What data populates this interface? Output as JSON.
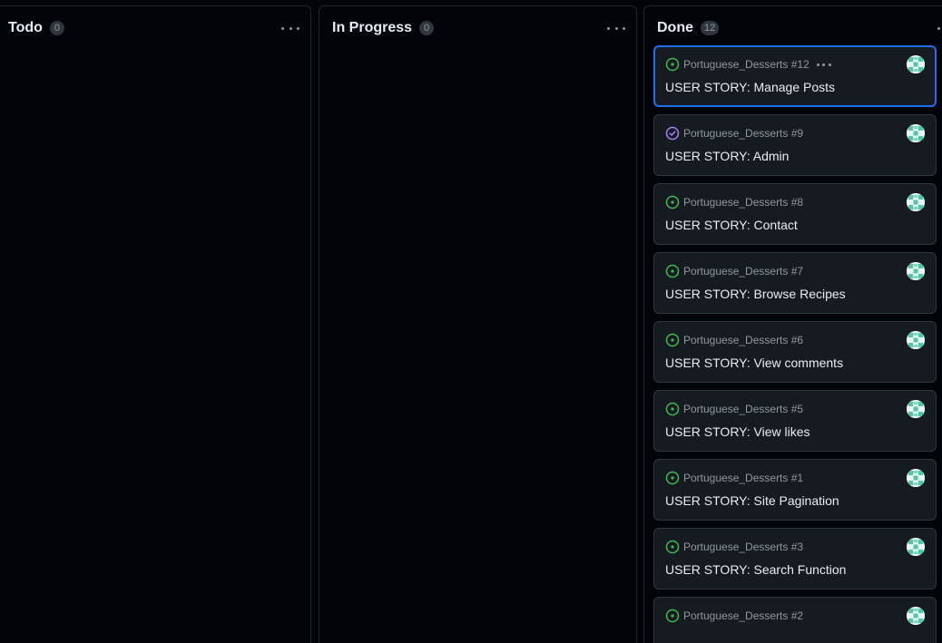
{
  "columns": [
    {
      "title": "Todo",
      "count": "0"
    },
    {
      "title": "In Progress",
      "count": "0"
    },
    {
      "title": "Done",
      "count": "12"
    }
  ],
  "done_cards": [
    {
      "ref": "Portuguese_Desserts #12",
      "title": "USER STORY: Manage Posts",
      "status": "open"
    },
    {
      "ref": "Portuguese_Desserts #9",
      "title": "USER STORY: Admin",
      "status": "completed"
    },
    {
      "ref": "Portuguese_Desserts #8",
      "title": "USER STORY: Contact",
      "status": "open"
    },
    {
      "ref": "Portuguese_Desserts #7",
      "title": "USER STORY: Browse Recipes",
      "status": "open"
    },
    {
      "ref": "Portuguese_Desserts #6",
      "title": "USER STORY: View comments",
      "status": "open"
    },
    {
      "ref": "Portuguese_Desserts #5",
      "title": "USER STORY: View likes",
      "status": "open"
    },
    {
      "ref": "Portuguese_Desserts #1",
      "title": "USER STORY: Site Pagination",
      "status": "open"
    },
    {
      "ref": "Portuguese_Desserts #3",
      "title": "USER STORY: Search Function",
      "status": "open"
    },
    {
      "ref": "Portuguese_Desserts #2",
      "title": "",
      "status": "open"
    }
  ],
  "colors": {
    "background": "#010409",
    "card": "#161b22",
    "border": "#30363d",
    "selected_border": "#1f6feb",
    "open_icon": "#3fb950",
    "completed_icon": "#ab7df8",
    "muted_text": "#9198a1"
  },
  "icons": {
    "open": "issue-opened-icon",
    "completed": "issue-closed-icon",
    "column_menu": "kebab-horizontal-icon",
    "avatar": "identicon-avatar"
  }
}
